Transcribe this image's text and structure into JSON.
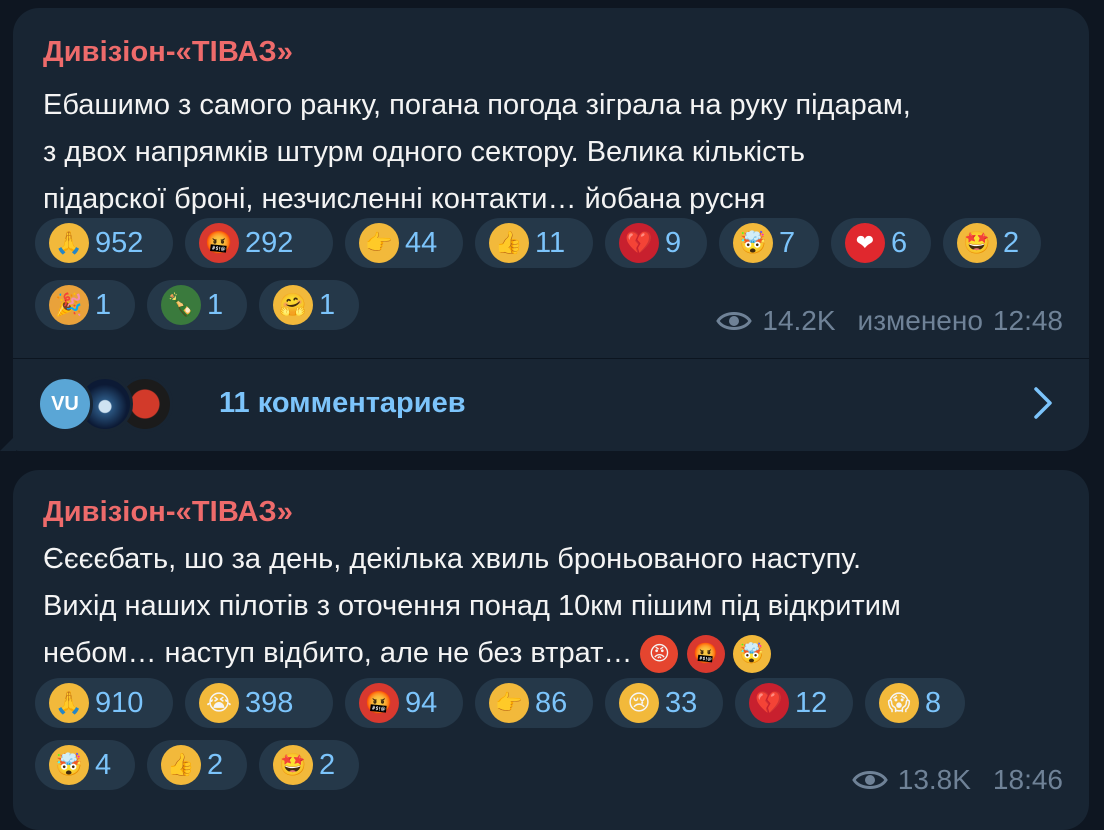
{
  "colors": {
    "background": "#0e1621",
    "bubble": "#182533",
    "author": "#ee6b6b",
    "link": "#7cc4fb",
    "meta": "#6f8297",
    "pill": "#253849"
  },
  "messages": [
    {
      "author": "Дивізіон-«ТІВАЗ»",
      "text_lines": [
        "Ебашимо з самого ранку, погана погода зіграла на руку підарам,",
        "з двох напрямків штурм одного сектору. Велика кількість",
        "підарскої броні, незчисленні контакти… йобана русня"
      ],
      "reactions": [
        {
          "icon": "praying-hands-icon",
          "glyph": "🙏",
          "count": "952"
        },
        {
          "icon": "cursing-face-icon",
          "glyph": "🤬",
          "count": "292"
        },
        {
          "icon": "pointing-hand-icon",
          "glyph": "👉",
          "count": "44"
        },
        {
          "icon": "thumbs-up-icon",
          "glyph": "👍",
          "count": "11"
        },
        {
          "icon": "broken-heart-icon",
          "glyph": "💔",
          "count": "9"
        },
        {
          "icon": "exploding-head-icon",
          "glyph": "🤯",
          "count": "7"
        },
        {
          "icon": "red-heart-icon",
          "glyph": "❤",
          "count": "6"
        },
        {
          "icon": "star-struck-icon",
          "glyph": "🤩",
          "count": "2"
        },
        {
          "icon": "party-popper-icon",
          "glyph": "🎉",
          "count": "1"
        },
        {
          "icon": "champagne-icon",
          "glyph": "🍾",
          "count": "1"
        },
        {
          "icon": "hugging-face-icon",
          "glyph": "🤗",
          "count": "1"
        }
      ],
      "views": "14.2K",
      "edited_label": "изменено",
      "time": "12:48",
      "comments": {
        "avatar_initials": "VU",
        "label": "11 комментариев"
      }
    },
    {
      "author": "Дивізіон-«ТІВАЗ»",
      "text_lines": [
        "Єєєєбать, шо за день, декілька хвиль броньованого наступу.",
        "Вихід наших пілотів з оточення понад 10км пішим під відкритим",
        "небом… наступ відбито, але не без втрат…"
      ],
      "inline_emoji": [
        {
          "icon": "angry-face-icon",
          "glyph": "😡"
        },
        {
          "icon": "cursing-face-icon",
          "glyph": "🤬"
        },
        {
          "icon": "exploding-head-icon",
          "glyph": "🤯"
        }
      ],
      "reactions": [
        {
          "icon": "praying-hands-icon",
          "glyph": "🙏",
          "count": "910"
        },
        {
          "icon": "loudly-crying-face-icon",
          "glyph": "😭",
          "count": "398"
        },
        {
          "icon": "cursing-face-icon",
          "glyph": "🤬",
          "count": "94"
        },
        {
          "icon": "pointing-hand-icon",
          "glyph": "👉",
          "count": "86"
        },
        {
          "icon": "crying-face-icon",
          "glyph": "😢",
          "count": "33"
        },
        {
          "icon": "broken-heart-icon",
          "glyph": "💔",
          "count": "12"
        },
        {
          "icon": "screaming-face-icon",
          "glyph": "😱",
          "count": "8"
        },
        {
          "icon": "exploding-head-icon",
          "glyph": "🤯",
          "count": "4"
        },
        {
          "icon": "thumbs-up-icon",
          "glyph": "👍",
          "count": "2"
        },
        {
          "icon": "star-struck-icon",
          "glyph": "🤩",
          "count": "2"
        }
      ],
      "views": "13.8K",
      "time": "18:46"
    }
  ]
}
